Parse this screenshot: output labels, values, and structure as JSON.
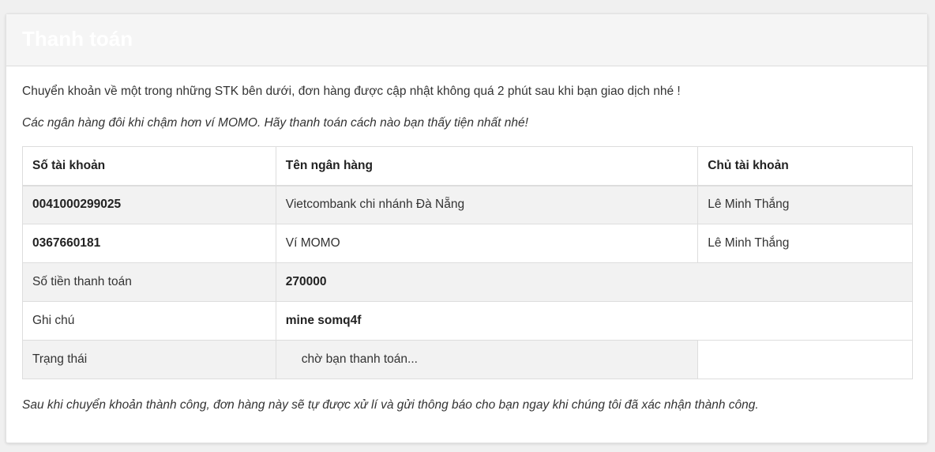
{
  "card": {
    "title": "Thanh toán"
  },
  "intro_text": "Chuyển khoản về một trong những STK bên dưới, đơn hàng được cập nhật không quá 2 phút sau khi bạn giao dịch nhé !",
  "italic_note": "Các ngân hàng đôi khi chậm hơn ví MOMO. Hãy thanh toán cách nào bạn thấy tiện nhất nhé!",
  "table": {
    "headers": [
      "Số tài khoản",
      "Tên ngân hàng",
      "Chủ tài khoản"
    ],
    "accounts": [
      {
        "number": "0041000299025",
        "bank": "Vietcombank chi nhánh Đà Nẵng",
        "owner": "Lê Minh Thắng"
      },
      {
        "number": "0367660181",
        "bank": "Ví MOMO",
        "owner": "Lê Minh Thắng"
      }
    ],
    "amount": {
      "label": "Số tiền thanh toán",
      "value": "270000"
    },
    "memo": {
      "label": "Ghi chú",
      "value": "mine somq4f"
    },
    "status": {
      "label": "Trạng thái",
      "value": "chờ bạn thanh toán..."
    }
  },
  "closing_text": "Sau khi chuyển khoản thành công, đơn hàng này sẽ tự được xử lí và gửi thông báo cho bạn ngay khi chúng tôi đã xác nhận thành công."
}
